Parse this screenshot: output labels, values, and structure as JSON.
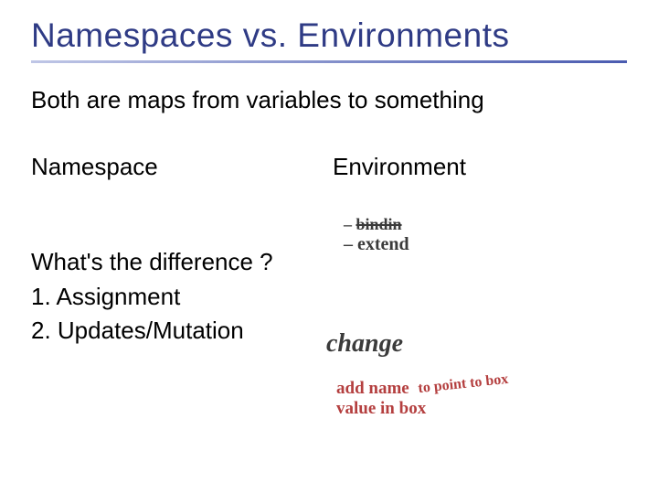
{
  "title": "Namespaces vs. Environments",
  "subtitle": "Both are maps from variables to something",
  "columns": {
    "left_heading": "Namespace",
    "right_heading": "Environment"
  },
  "body": {
    "question": "What's the difference ?",
    "item1": "1. Assignment",
    "item2": "2. Updates/Mutation"
  },
  "annotations": {
    "binding_dash": "– ",
    "binding_struck": "bindin",
    "extend": "– extend",
    "change": "change",
    "addname_line1_a": "add name",
    "addname_line1_b": "to point to box",
    "addname_line2": "value in box"
  }
}
